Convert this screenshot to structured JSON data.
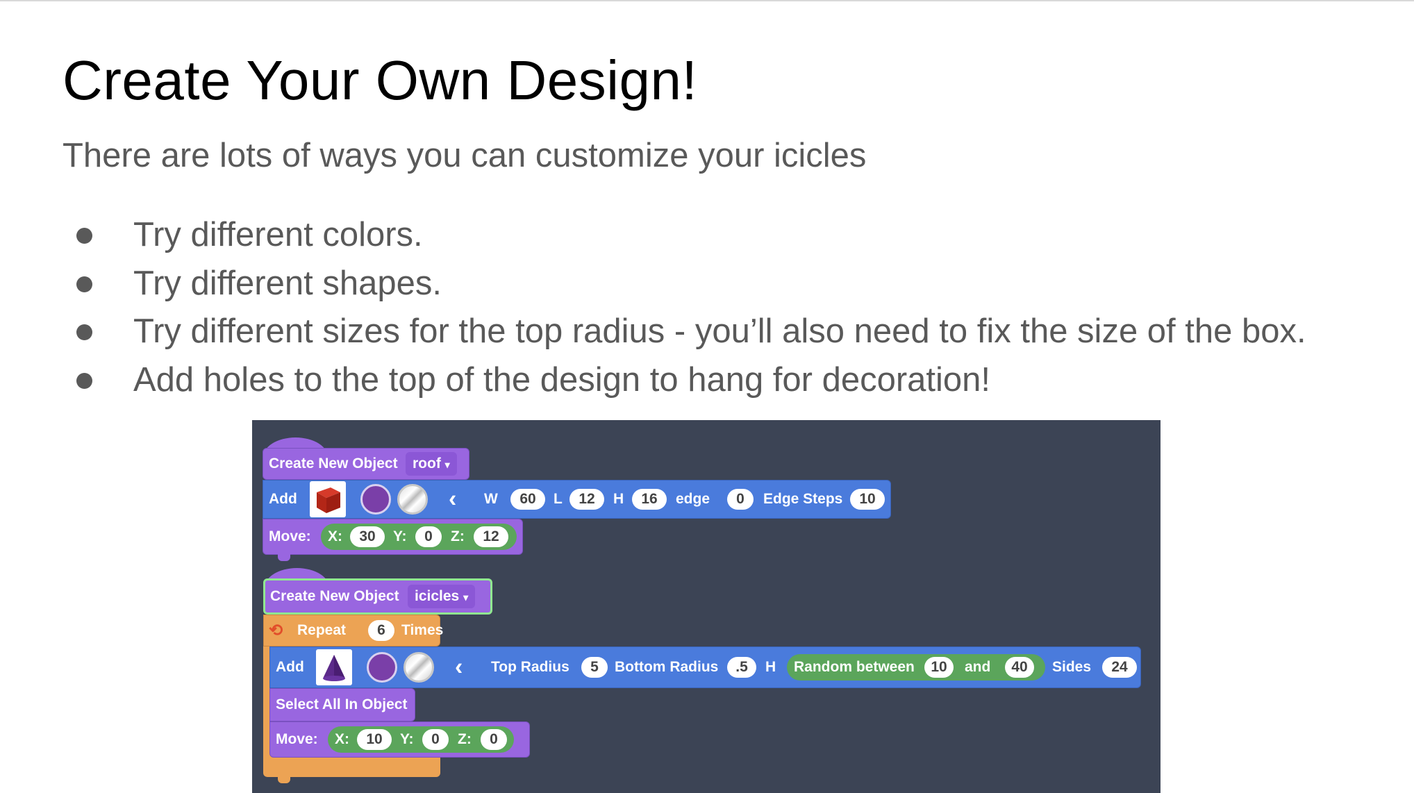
{
  "slide": {
    "title": "Create Your Own Design!",
    "subtitle": "There are lots of ways you can customize your icicles",
    "bullets": [
      "Try different colors.",
      "Try different shapes.",
      "Try different sizes for the top radius - you’ll also need to fix the size of the box.",
      "Add holes to the top of the design to hang for decoration!"
    ]
  },
  "code": {
    "block1": {
      "create_label": "Create New Object",
      "object_name": "roof",
      "add_label": "Add",
      "shape_icon": "red-cube-icon",
      "w_label": "W",
      "w_value": "60",
      "l_label": "L",
      "l_value": "12",
      "h_label": "H",
      "h_value": "16",
      "edge_label": "edge",
      "edge_value": "0",
      "edge_steps_label": "Edge Steps",
      "edge_steps_value": "10",
      "move_label": "Move:",
      "x_label": "X:",
      "x_value": "30",
      "y_label": "Y:",
      "y_value": "0",
      "z_label": "Z:",
      "z_value": "12"
    },
    "block2": {
      "create_label": "Create New Object",
      "object_name": "icicles",
      "repeat_label": "Repeat",
      "repeat_value": "6",
      "times_label": "Times",
      "add_label": "Add",
      "shape_icon": "purple-cone-icon",
      "top_radius_label": "Top Radius",
      "top_radius_value": "5",
      "bottom_radius_label": "Bottom Radius",
      "bottom_radius_value": ".5",
      "h_label": "H",
      "random_label": "Random between",
      "random_min": "10",
      "and_label": "and",
      "random_max": "40",
      "sides_label": "Sides",
      "sides_value": "24",
      "select_label": "Select All In Object",
      "move_label": "Move:",
      "x_label": "X:",
      "x_value": "10",
      "y_label": "Y:",
      "y_value": "0",
      "z_label": "Z:",
      "z_value": "0"
    },
    "colors": {
      "background": "#3c4455",
      "purple_block": "#9966e0",
      "blue_block": "#4a7bdc",
      "orange_block": "#eca354",
      "green_block": "#5ba55b",
      "color_swatch": "#7a3fa8"
    }
  }
}
